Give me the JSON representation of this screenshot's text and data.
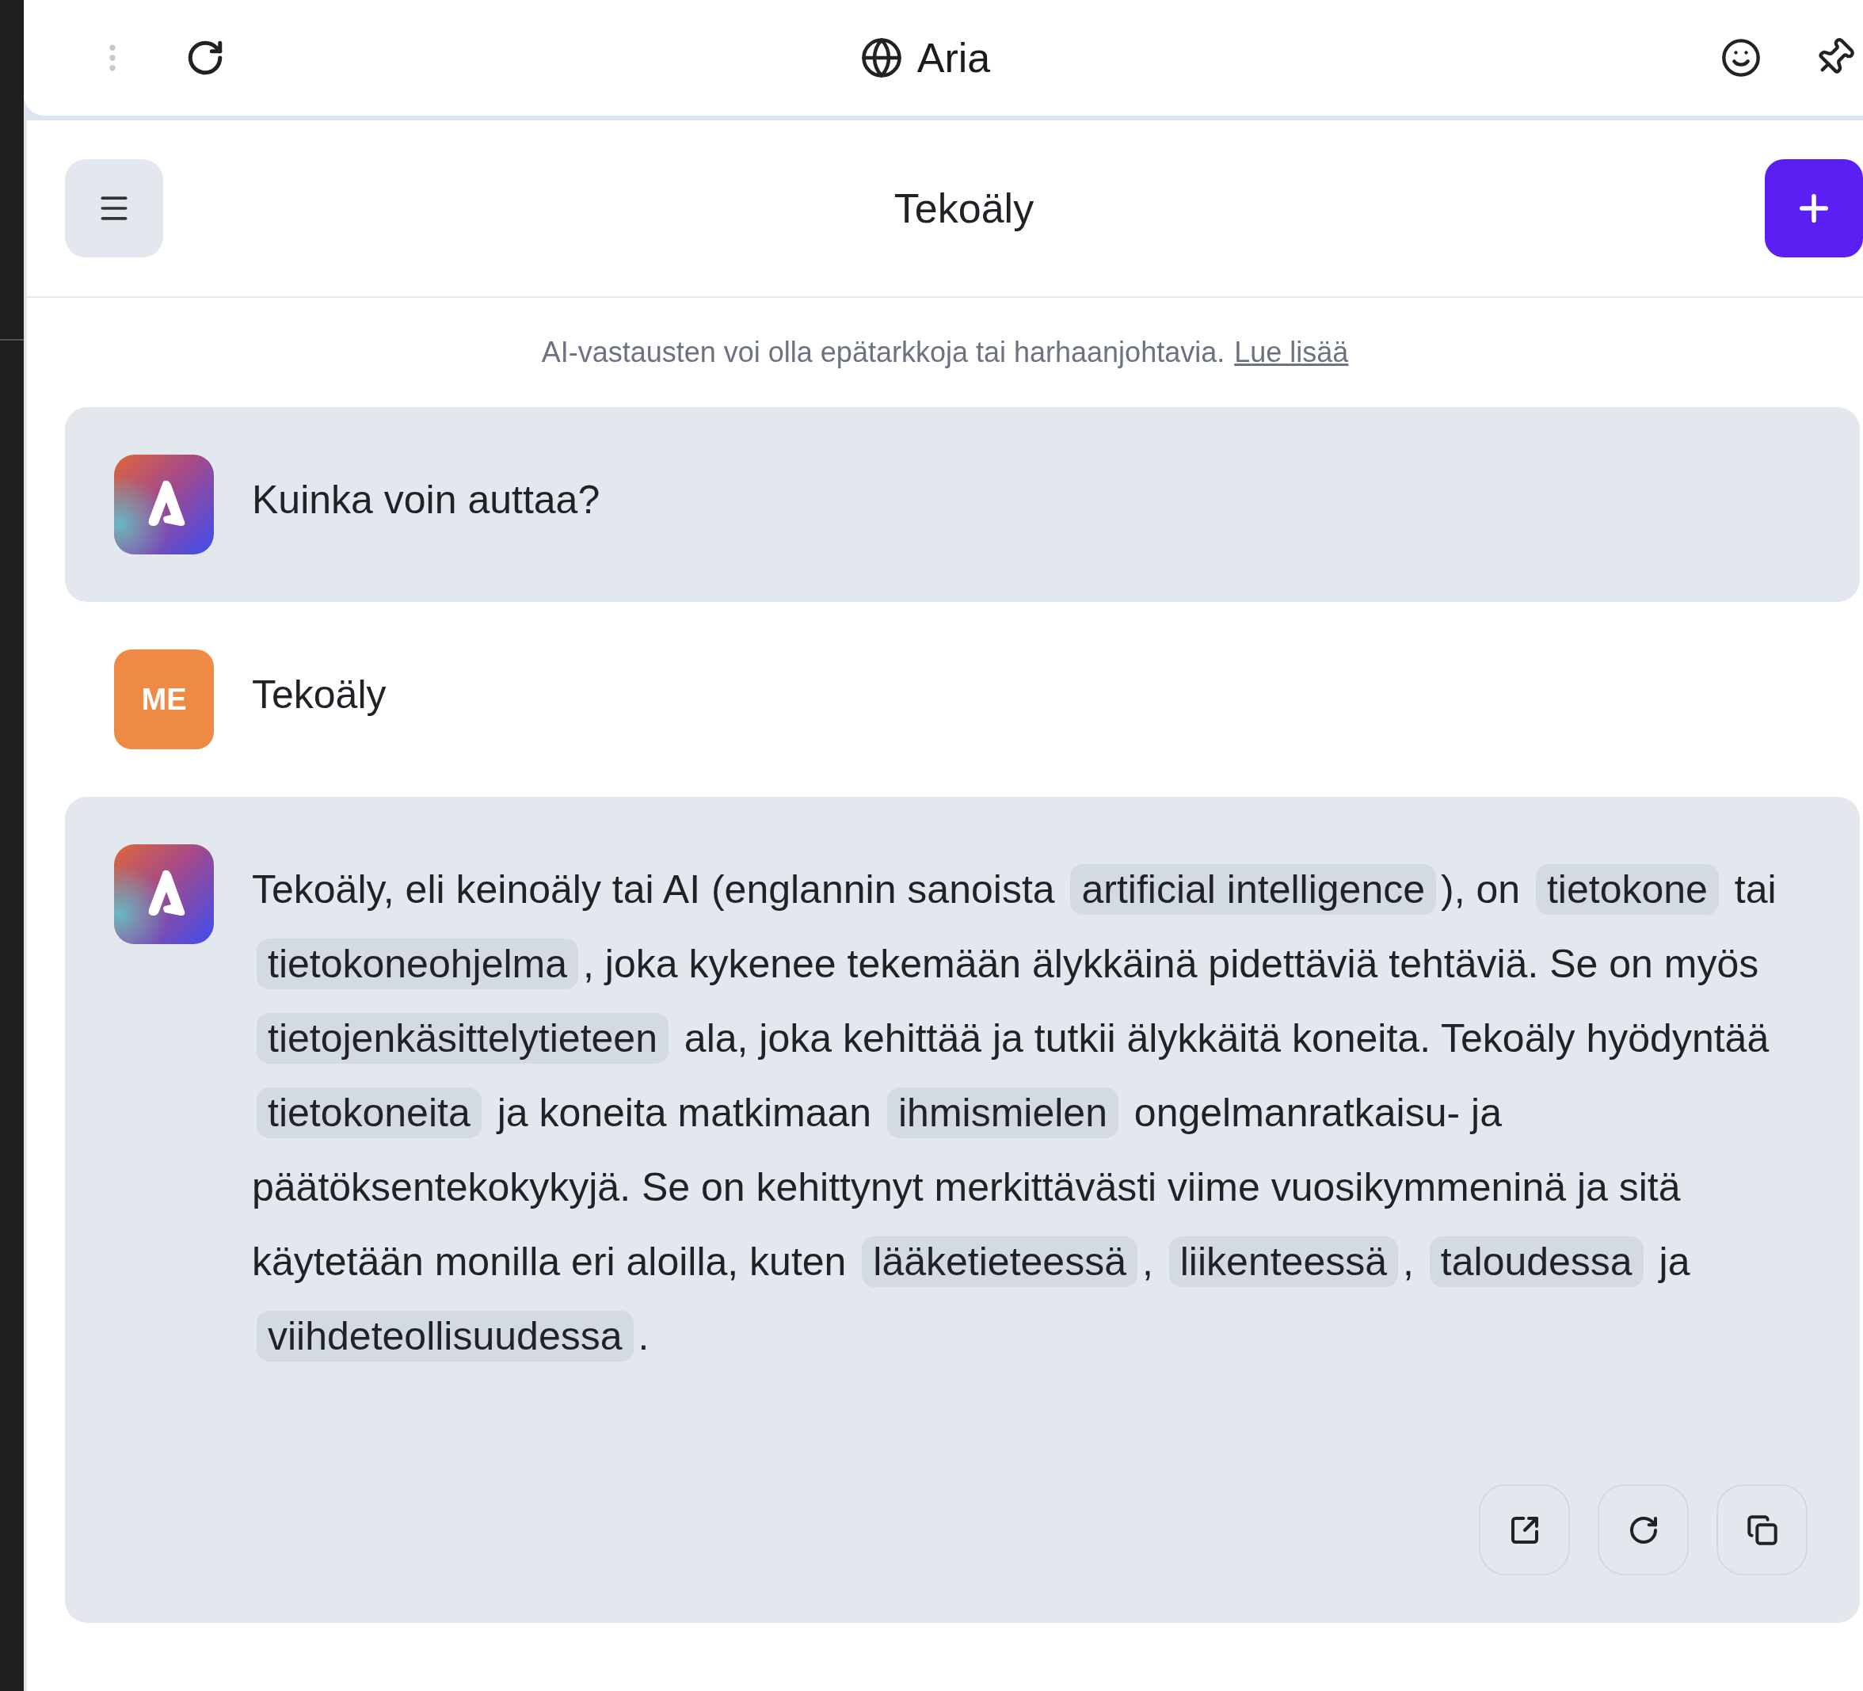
{
  "top_bar": {
    "title": "Aria"
  },
  "header": {
    "title": "Tekoäly"
  },
  "notice": {
    "text": "AI-vastausten voi olla epätarkkoja tai harhaanjohtavia.",
    "link": "Lue lisää"
  },
  "messages": [
    {
      "kind": "assistant",
      "show_actions": false,
      "segments": [
        {
          "kind": "plain",
          "text": "Kuinka voin auttaa?"
        }
      ]
    },
    {
      "kind": "user",
      "avatar": "ME",
      "show_actions": false,
      "segments": [
        {
          "kind": "plain",
          "text": "Tekoäly"
        }
      ]
    },
    {
      "kind": "assistant",
      "show_actions": true,
      "segments": [
        {
          "kind": "plain",
          "text": "Tekoäly, eli keinoäly tai AI (englannin sanoista "
        },
        {
          "kind": "term",
          "text": "artificial intelligence"
        },
        {
          "kind": "plain",
          "text": "), on "
        },
        {
          "kind": "term",
          "text": "tietokone"
        },
        {
          "kind": "plain",
          "text": " tai "
        },
        {
          "kind": "term",
          "text": "tietokoneohjelma"
        },
        {
          "kind": "plain",
          "text": ", joka kykenee tekemään älykkäinä pidettäviä tehtäviä. Se on myös "
        },
        {
          "kind": "term",
          "text": "tietojenkäsittelytieteen"
        },
        {
          "kind": "plain",
          "text": " ala, joka kehittää ja tutkii älykkäitä koneita. Tekoäly hyödyntää "
        },
        {
          "kind": "term",
          "text": "tietokoneita"
        },
        {
          "kind": "plain",
          "text": " ja koneita matkimaan "
        },
        {
          "kind": "term",
          "text": "ihmismielen"
        },
        {
          "kind": "plain",
          "text": " ongelmanratkaisu- ja päätöksentekokykyjä. Se on kehittynyt merkittävästi viime vuosikymmeninä ja sitä käytetään monilla eri aloilla, kuten "
        },
        {
          "kind": "term",
          "text": "lääketieteessä"
        },
        {
          "kind": "plain",
          "text": ", "
        },
        {
          "kind": "term",
          "text": "liikenteessä"
        },
        {
          "kind": "plain",
          "text": ", "
        },
        {
          "kind": "term",
          "text": "taloudessa"
        },
        {
          "kind": "plain",
          "text": " ja "
        },
        {
          "kind": "term",
          "text": "viihdeteollisuudessa"
        },
        {
          "kind": "plain",
          "text": "."
        }
      ]
    }
  ]
}
